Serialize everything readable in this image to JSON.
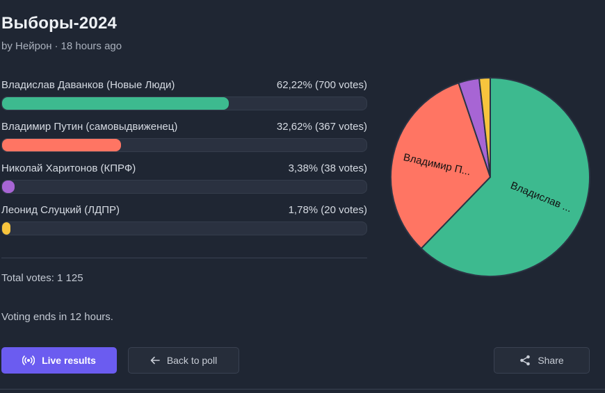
{
  "poll": {
    "title": "Выборы-2024",
    "author_prefix": "by",
    "author": "Нейрон",
    "separator": "·",
    "time_ago": "18 hours ago"
  },
  "options": [
    {
      "label": "Владислав Даванков (Новые Люди)",
      "percent_text": "62,22% (700 votes)",
      "percent": 62.22,
      "color": "#3dba8f"
    },
    {
      "label": "Владимир Путин (самовыдвиженец)",
      "percent_text": "32,62% (367 votes)",
      "percent": 32.62,
      "color": "#ff7563"
    },
    {
      "label": "Николай Харитонов (КПРФ)",
      "percent_text": "3,38% (38 votes)",
      "percent": 3.38,
      "color": "#a765d4"
    },
    {
      "label": "Леонид Слуцкий (ЛДПР)",
      "percent_text": "1,78% (20 votes)",
      "percent": 1.78,
      "color": "#f7c43d"
    }
  ],
  "total_votes_text": "Total votes: 1 125",
  "voting_ends_text": "Voting ends in 12 hours.",
  "buttons": {
    "live_results": "Live results",
    "back_to_poll": "Back to poll",
    "share": "Share"
  },
  "icons": {
    "live": "broadcast-icon",
    "back": "arrow-left-icon",
    "share": "share-icon"
  },
  "chart_data": {
    "type": "pie",
    "categories": [
      "Владислав Даванков (Новые Люди)",
      "Владимир Путин (самовыдвиженец)",
      "Николай Харитонов (КПРФ)",
      "Леонид Слуцкий (ЛДПР)"
    ],
    "values": [
      62.22,
      32.62,
      3.38,
      1.78
    ],
    "colors": [
      "#3dba8f",
      "#ff7563",
      "#a765d4",
      "#f7c43d"
    ],
    "slice_labels": [
      "Владислав ...",
      "Владимир П...",
      "",
      ""
    ]
  }
}
